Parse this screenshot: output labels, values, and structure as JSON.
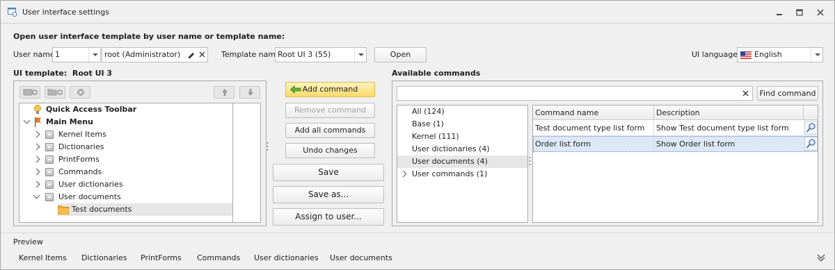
{
  "window": {
    "title": "User interface settings",
    "title_icon": "settings-window-icon",
    "controls": [
      "minimize-icon",
      "restore-icon",
      "close-icon"
    ]
  },
  "header": {
    "heading": "Open user interface template by user name or template name:",
    "user_name_label": "User name",
    "user_id_value": "1",
    "user_name_value": "root (Administrator)",
    "template_name_label": "Template name",
    "template_value": "Root UI 3 (55)",
    "open_label": "Open",
    "ui_language_label": "UI language:",
    "ui_language_value": "English",
    "language_flag_icon": "us-flag-icon"
  },
  "template_panel": {
    "label": "UI template:",
    "template_name": "Root UI 3",
    "toolbar_icons": [
      "add-item-icon",
      "add-folder-icon",
      "delete-icon",
      "move-up-icon",
      "move-down-icon"
    ],
    "tree": [
      {
        "label": "Quick Access Toolbar",
        "icon": "lightbulb-icon",
        "bold": true,
        "level": 0,
        "expander": "none"
      },
      {
        "label": "Main Menu",
        "icon": "flag-icon",
        "bold": true,
        "level": 0,
        "expander": "expanded"
      },
      {
        "label": "Kernel Items",
        "icon": "menu-node-icon",
        "bold": false,
        "level": 1,
        "expander": "collapsed"
      },
      {
        "label": "Dictionaries",
        "icon": "menu-node-icon",
        "bold": false,
        "level": 1,
        "expander": "collapsed"
      },
      {
        "label": "PrintForms",
        "icon": "menu-node-icon",
        "bold": false,
        "level": 1,
        "expander": "collapsed"
      },
      {
        "label": "Commands",
        "icon": "menu-node-icon",
        "bold": false,
        "level": 1,
        "expander": "collapsed"
      },
      {
        "label": "User dictionaries",
        "icon": "menu-node-icon",
        "bold": false,
        "level": 1,
        "expander": "collapsed"
      },
      {
        "label": "User documents",
        "icon": "menu-node-icon",
        "bold": false,
        "level": 1,
        "expander": "expanded"
      },
      {
        "label": "Test documents",
        "icon": "folder-icon",
        "bold": false,
        "level": 2,
        "expander": "none",
        "selected": true
      }
    ]
  },
  "actions": {
    "add_command": "Add command",
    "remove_command": "Remove command",
    "add_all_commands": "Add all commands",
    "undo_changes": "Undo changes",
    "save": "Save",
    "save_as": "Save as...",
    "assign_to_user": "Assign to user..."
  },
  "commands_panel": {
    "label": "Available commands",
    "search_value": "",
    "find_command": "Find command",
    "categories": [
      {
        "label": "All (124)",
        "selected": false,
        "expander": false
      },
      {
        "label": "Base (1)",
        "selected": false,
        "expander": false
      },
      {
        "label": "Kernel (111)",
        "selected": false,
        "expander": false
      },
      {
        "label": "User dictionaries (4)",
        "selected": false,
        "expander": false
      },
      {
        "label": "User documents (4)",
        "selected": true,
        "expander": false
      },
      {
        "label": "User commands (1)",
        "selected": false,
        "expander": true
      }
    ],
    "columns": [
      "Command name",
      "Description"
    ],
    "rows": [
      {
        "name": "Test document type list form",
        "description": "Show Test document type list form",
        "selected": false
      },
      {
        "name": "Order list form",
        "description": "Show Order list form",
        "selected": true
      }
    ]
  },
  "preview": {
    "label": "Preview",
    "tabs": [
      "Kernel Items",
      "Dictionaries",
      "PrintForms",
      "Commands",
      "User dictionaries",
      "User documents"
    ]
  },
  "colors": {
    "accent_highlight": "#fbd96a",
    "selection_row": "#dde8f6",
    "border": "#a9a9a9"
  }
}
